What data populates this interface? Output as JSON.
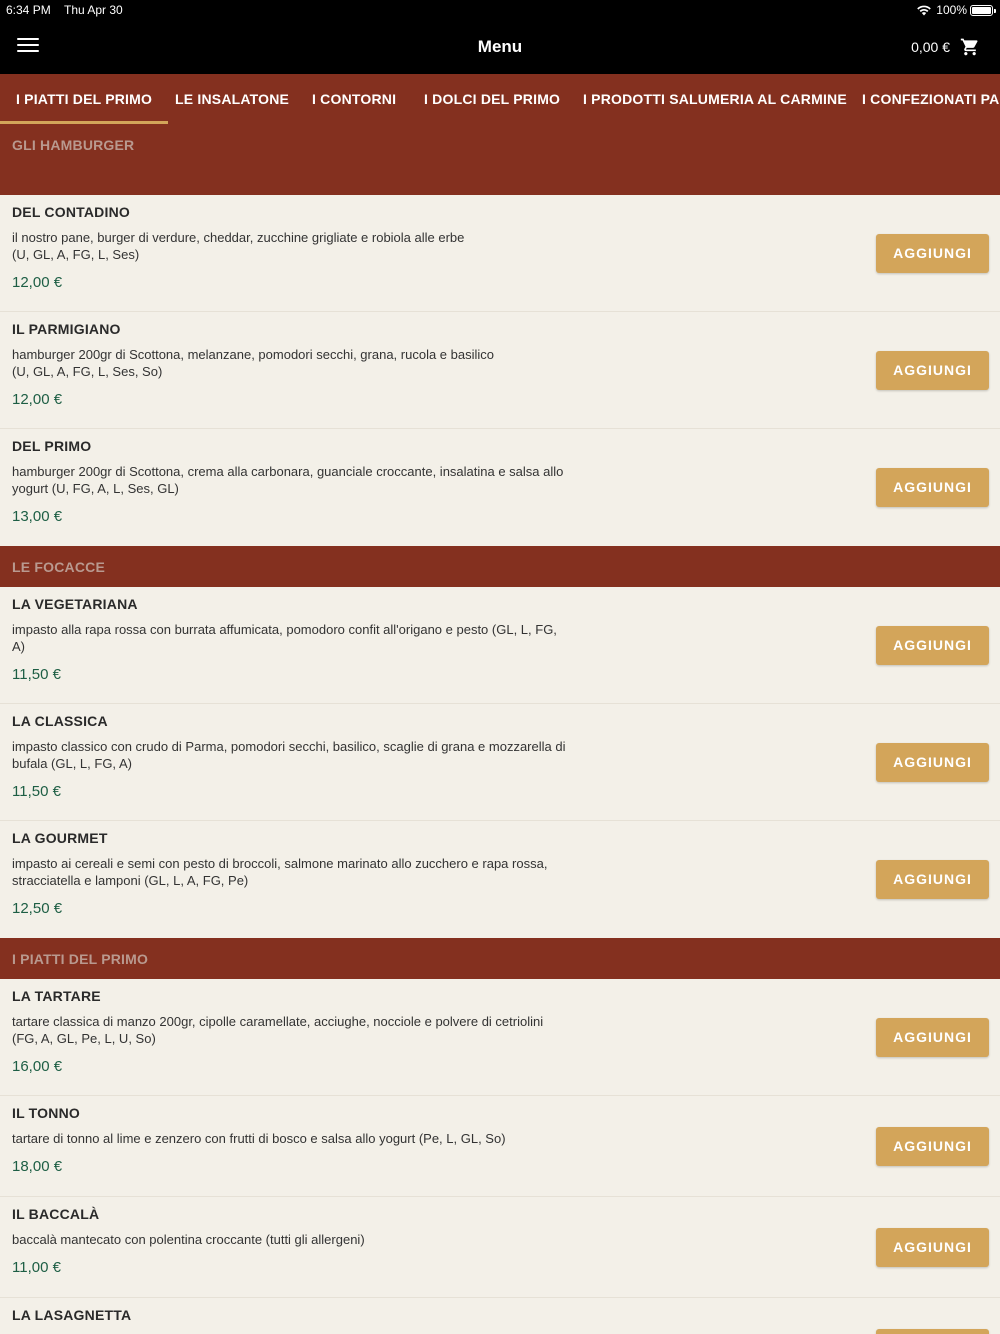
{
  "status_bar": {
    "time": "6:34 PM",
    "date": "Thu Apr 30",
    "battery": "100%"
  },
  "header": {
    "title": "Menu",
    "cart_total": "0,00 €",
    "menu_icon": "hamburger-menu-icon",
    "cart_icon": "shopping-cart-icon"
  },
  "tabs": [
    {
      "label": "I PIATTI DEL PRIMO",
      "active": true
    },
    {
      "label": "LE INSALATONE"
    },
    {
      "label": "I CONTORNI"
    },
    {
      "label": "I DOLCI DEL PRIMO"
    },
    {
      "label": "I PRODOTTI SALUMERIA AL CARMINE"
    },
    {
      "label": "I CONFEZIONATI PAN"
    }
  ],
  "add_label": "AGGIUNGI",
  "sections": [
    {
      "title": "GLI HAMBURGER",
      "items": [
        {
          "name": "DEL CONTADINO",
          "desc": " il nostro pane, burger di verdure, cheddar, zucchine grigliate e robiola alle erbe\n(U, GL, A, FG, L, Ses)",
          "price": "12,00 €"
        },
        {
          "name": "IL PARMIGIANO",
          "desc": "hamburger 200gr di Scottona, melanzane, pomodori secchi, grana, rucola e basilico\n(U, GL, A, FG, L, Ses, So)",
          "price": "12,00 €"
        },
        {
          "name": "DEL PRIMO",
          "desc": "hamburger 200gr di Scottona, crema alla carbonara, guanciale croccante, insalatina e salsa allo\nyogurt (U, FG, A, L, Ses, GL)",
          "price": "13,00 €"
        }
      ]
    },
    {
      "title": "LE FOCACCE",
      "items": [
        {
          "name": "LA VEGETARIANA",
          "desc": "impasto alla rapa rossa con burrata affumicata, pomodoro confit all'origano e pesto (GL, L, FG,\nA)",
          "price": "11,50 €"
        },
        {
          "name": "LA CLASSICA",
          "desc": "impasto classico con crudo di Parma, pomodori secchi, basilico, scaglie di grana e mozzarella di\nbufala (GL, L, FG, A)",
          "price": "11,50 €"
        },
        {
          "name": "LA GOURMET",
          "desc": "impasto ai cereali e semi con pesto di broccoli, salmone marinato allo zucchero e rapa rossa,\nstracciatella e lamponi (GL, L, A, FG, Pe)",
          "price": "12,50 €"
        }
      ]
    },
    {
      "title": "I PIATTI DEL PRIMO",
      "items": [
        {
          "name": "LA TARTARE",
          "desc": "tartare classica di manzo 200gr, cipolle caramellate, acciughe, nocciole e polvere di cetriolini\n(FG, A, GL, Pe, L, U, So)",
          "price": "16,00 €"
        },
        {
          "name": "IL TONNO",
          "desc": "tartare di tonno al lime e zenzero con frutti di bosco e salsa allo yogurt (Pe, L, GL, So)",
          "price": "18,00 €"
        },
        {
          "name": "IL BACCALÀ",
          "desc": "baccalà mantecato con polentina croccante (tutti gli allergeni)",
          "price": "11,00 €"
        },
        {
          "name": "LA LASAGNETTA",
          "desc": "",
          "price": ""
        }
      ]
    }
  ]
}
